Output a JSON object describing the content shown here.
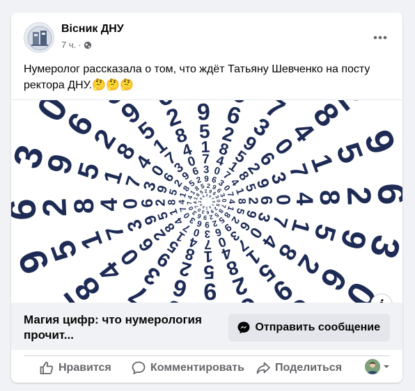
{
  "post": {
    "page_name": "Вісник ДНУ",
    "time": "7 ч.",
    "separator": "·",
    "privacy_icon": "globe-icon",
    "text": "Нумеролог рассказала о том, что ждёт Татьяну Шевченко на посту ректора ДНУ.🤔🤔🤔",
    "more_icon": "more-horizontal-icon"
  },
  "image": {
    "alt_subject": "spiral of digits",
    "info_icon": "info-icon",
    "info_label": "i",
    "digit_color": "#1d2b55"
  },
  "link": {
    "title": "Магия цифр: что нумерология прочит...",
    "send_label": "Отправить сообщение",
    "messenger_icon": "messenger-icon"
  },
  "actions": {
    "like_label": "Нравится",
    "comment_label": "Комментировать",
    "share_label": "Поделиться",
    "like_icon": "thumbs-up-icon",
    "comment_icon": "comment-icon",
    "share_icon": "share-icon",
    "profile_icon": "avatar",
    "dropdown_icon": "caret-down-icon"
  },
  "colors": {
    "background": "#f0f2f5",
    "card": "#ffffff",
    "secondary_text": "#65676b",
    "button_bg": "#e4e6eb"
  }
}
